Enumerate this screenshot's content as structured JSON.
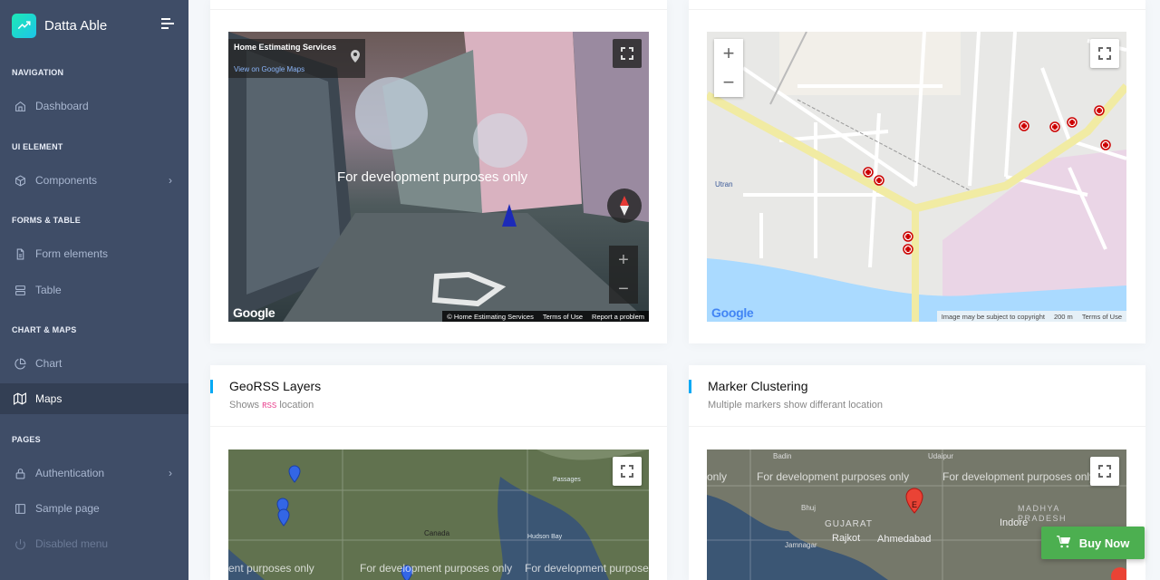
{
  "brand": {
    "name": "Datta Able"
  },
  "nav": {
    "captions": [
      "NAVIGATION",
      "UI ELEMENT",
      "FORMS & TABLE",
      "CHART & MAPS",
      "PAGES"
    ],
    "items": [
      {
        "label": "Dashboard",
        "icon": "home-icon"
      },
      {
        "label": "Components",
        "icon": "box-icon"
      },
      {
        "label": "Form elements",
        "icon": "file-text-icon"
      },
      {
        "label": "Table",
        "icon": "server-icon"
      },
      {
        "label": "Chart",
        "icon": "pie-chart-icon"
      },
      {
        "label": "Maps",
        "icon": "map-icon",
        "active": true
      },
      {
        "label": "Authentication",
        "icon": "lock-icon"
      },
      {
        "label": "Sample page",
        "icon": "sidebar-icon"
      },
      {
        "label": "Disabled menu",
        "icon": "power-icon",
        "disabled": true
      }
    ]
  },
  "street_view": {
    "place_title": "Home Estimating Services",
    "view_link": "View on Google Maps",
    "watermark": "For development purposes only",
    "logo": "Google",
    "footer": [
      "© Home Estimating Services",
      "Terms of Use",
      "Report a problem"
    ],
    "zoom_in": "+",
    "zoom_out": "−"
  },
  "road_map": {
    "zoom_in": "+",
    "zoom_out": "−",
    "place_label": "Utran",
    "logo": "Google",
    "footer": [
      "Image may be subject to copyright",
      "200 m",
      "Terms of Use"
    ]
  },
  "georss": {
    "title": "GeoRSS Layers",
    "subtitle_before": "Shows",
    "subtitle_tag": "RSS",
    "subtitle_after": "location",
    "labels": [
      "Canada",
      "Hudson Bay",
      "Passages"
    ],
    "watermark_1": "ent purposes only",
    "watermark_2": "For development purposes only",
    "watermark_3": "For development purposes only"
  },
  "clustering": {
    "title": "Marker Clustering",
    "subtitle": "Multiple markers show differant location",
    "labels": [
      "Badin",
      "Udaipur",
      "Bhuj",
      "GUJARAT",
      "Rajkot",
      "Ahmedabad",
      "Indore",
      "MADHYA PRADESH",
      "Jamnagar",
      "only"
    ],
    "marker_letter": "E",
    "watermark_1": "For development purposes only",
    "watermark_2": "For development purposes only"
  },
  "buy_now": {
    "label": "Buy Now"
  },
  "colors": {
    "sidebar": "#3f4d67",
    "accent": "#04a9f5",
    "buy": "#4caf50"
  }
}
